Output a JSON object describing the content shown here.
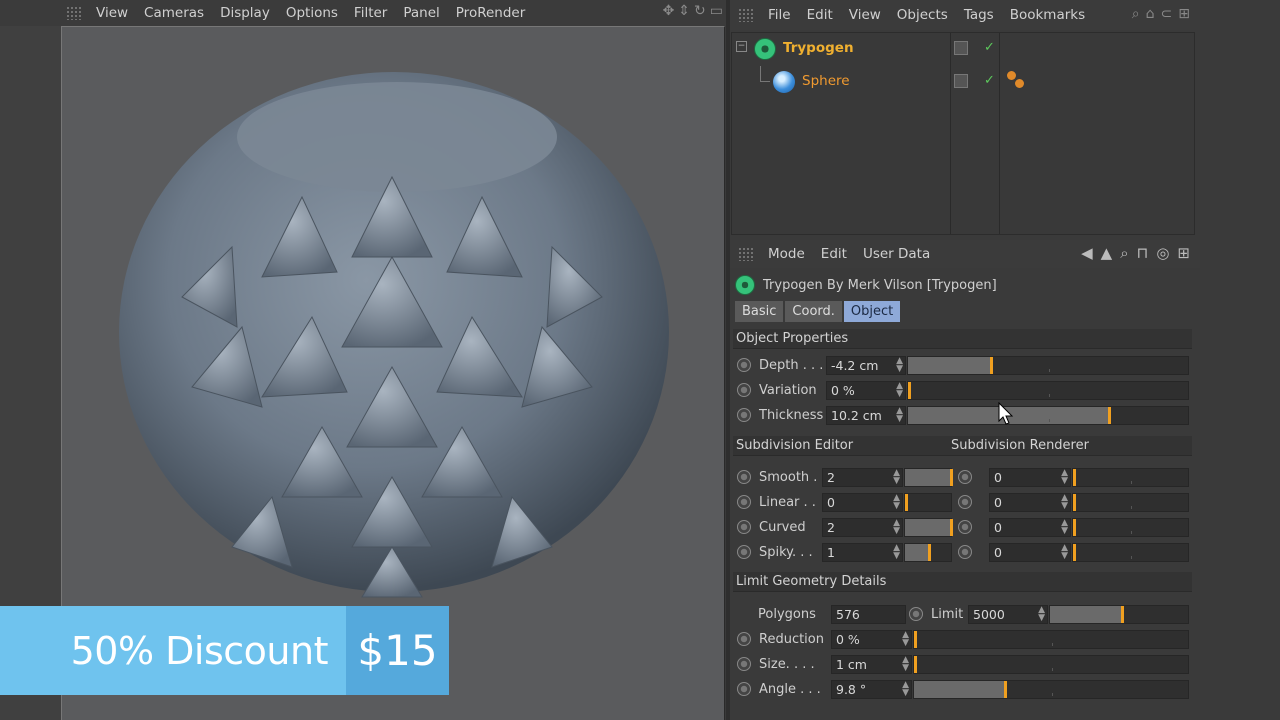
{
  "viewport": {
    "menu": [
      "View",
      "Cameras",
      "Display",
      "Options",
      "Filter",
      "Panel",
      "ProRender"
    ]
  },
  "promo": {
    "text": "50% Discount",
    "price": "$15"
  },
  "object_manager": {
    "menu": [
      "File",
      "Edit",
      "View",
      "Objects",
      "Tags",
      "Bookmarks"
    ],
    "objects": [
      {
        "name": "Trypogen",
        "icon": "trypogen-icon",
        "color": "#f0b030"
      },
      {
        "name": "Sphere",
        "icon": "sphere-icon",
        "color": "#f09a30"
      }
    ]
  },
  "attribute_manager": {
    "menu": [
      "Mode",
      "Edit",
      "User Data"
    ],
    "title": "Trypogen By Merk Vilson [Trypogen]",
    "tabs": [
      "Basic",
      "Coord.",
      "Object"
    ],
    "active_tab": "Object",
    "object_properties": {
      "heading": "Object Properties",
      "rows": [
        {
          "label": "Depth . . .",
          "value": "-4.2 cm",
          "slider": 0.3
        },
        {
          "label": "Variation",
          "value": "0 %",
          "slider": 0.0
        },
        {
          "label": "Thickness",
          "value": "10.2 cm",
          "slider": 0.72
        }
      ]
    },
    "subdivision": {
      "editor_heading": "Subdivision Editor",
      "renderer_heading": "Subdivision Renderer",
      "rows": [
        {
          "label": "Smooth .",
          "value": "2",
          "render_value": "0"
        },
        {
          "label": "Linear . .",
          "value": "0",
          "render_value": "0"
        },
        {
          "label": "Curved",
          "value": "2",
          "render_value": "0"
        },
        {
          "label": "Spiky. . .",
          "value": "1",
          "render_value": "0"
        }
      ]
    },
    "limit": {
      "heading": "Limit Geometry Details",
      "polygons_label": "Polygons",
      "polygons_value": "576",
      "limit_label": "Limit",
      "limit_value": "5000",
      "rows": [
        {
          "label": "Reduction",
          "value": "0 %"
        },
        {
          "label": "Size. . . .",
          "value": "1 cm"
        },
        {
          "label": "Angle . . .",
          "value": "9.8 °"
        }
      ]
    }
  },
  "colors": {
    "accent_orange": "#f0a020",
    "active_tab": "#8ea9d8",
    "promo_blue": "#6fc3ee"
  }
}
